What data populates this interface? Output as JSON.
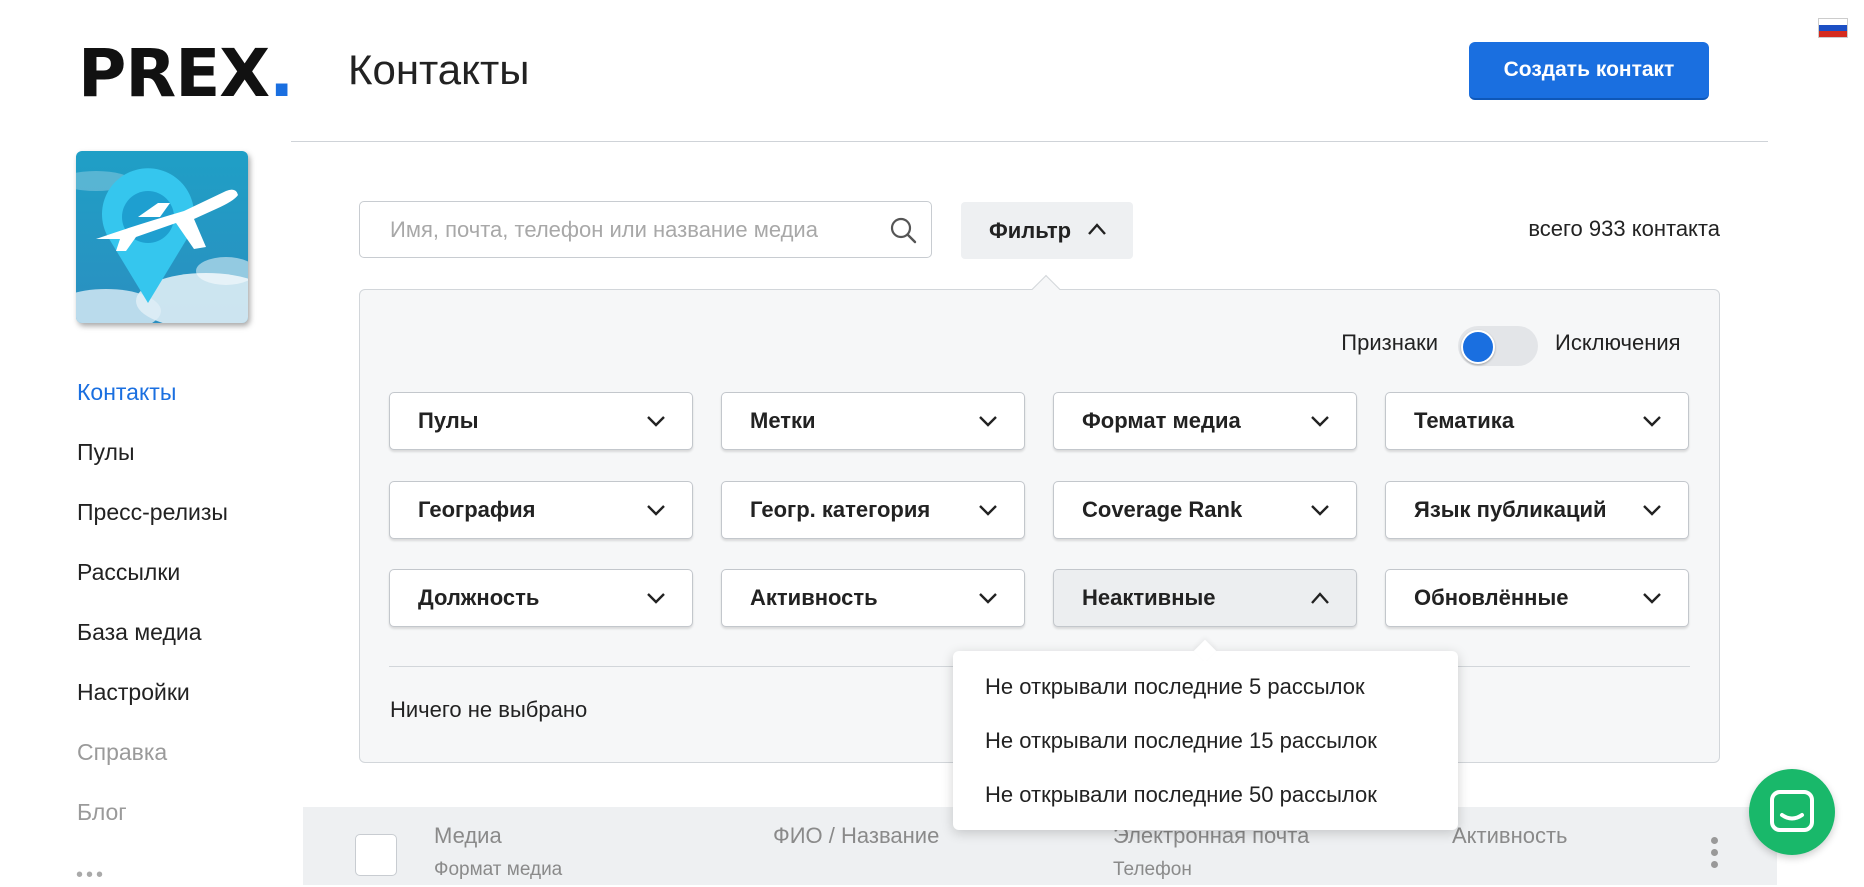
{
  "app": {
    "logo_text": "PREX",
    "logo_dot": ".",
    "page_title": "Контакты",
    "create_button": "Создать контакт",
    "language_flag": "russian-flag-icon"
  },
  "sidebar": {
    "items": [
      {
        "label": "Контакты",
        "state": "active"
      },
      {
        "label": "Пулы",
        "state": "normal"
      },
      {
        "label": "Пресс-релизы",
        "state": "normal"
      },
      {
        "label": "Рассылки",
        "state": "normal"
      },
      {
        "label": "База медиа",
        "state": "normal"
      },
      {
        "label": "Настройки",
        "state": "normal"
      },
      {
        "label": "Справка",
        "state": "muted"
      },
      {
        "label": "Блог",
        "state": "muted"
      }
    ],
    "more": "•••"
  },
  "search": {
    "placeholder": "Имя, почта, телефон или название медиа",
    "value": ""
  },
  "filter": {
    "button_label": "Фильтр",
    "total_prefix": "всего",
    "total_count": "933",
    "total_suffix": "контакта",
    "toggle_left": "Признаки",
    "toggle_right": "Исключения",
    "dropdowns": [
      "Пулы",
      "Метки",
      "Формат медиа",
      "Тематика",
      "География",
      "Геогр. категория",
      "Coverage Rank",
      "Язык публикаций",
      "Должность",
      "Активность",
      "Неактивные",
      "Обновлённые"
    ],
    "open_dropdown": "Неактивные",
    "selection_summary": "Ничего не выбрано",
    "open_menu_options": [
      "Не открывали последние 5 рассылок",
      "Не открывали последние 15 рассылок",
      "Не открывали последние 50 рассылок"
    ]
  },
  "table_header": {
    "col1": "Медиа",
    "col1_sub": "Формат медиа",
    "col2": "ФИО / Название",
    "col3": "Электронная почта",
    "col3_sub": "Телефон",
    "col4": "Активность"
  },
  "colors": {
    "accent": "#1a6fe0",
    "chat": "#19b86a"
  }
}
